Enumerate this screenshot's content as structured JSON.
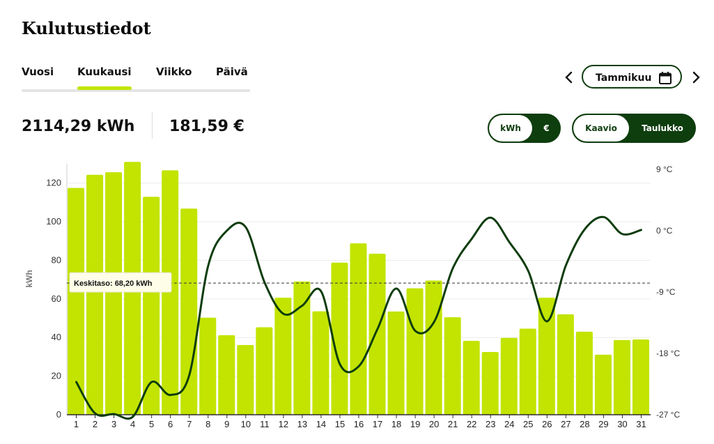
{
  "page": {
    "title": "Kulutustiedot"
  },
  "tabs": [
    {
      "label": "Vuosi",
      "active": false
    },
    {
      "label": "Kuukausi",
      "active": true
    },
    {
      "label": "Viikko",
      "active": false
    },
    {
      "label": "Päivä",
      "active": false
    }
  ],
  "month_selector": {
    "label": "Tammikuu",
    "prev_icon": "chevron-left-icon",
    "next_icon": "chevron-right-icon",
    "calendar_icon": "calendar-icon"
  },
  "totals": {
    "energy": "2114,29 kWh",
    "cost": "181,59 €"
  },
  "unit_toggle": {
    "options": [
      "kWh",
      "€"
    ],
    "selected": "kWh"
  },
  "view_toggle": {
    "options": [
      "Kaavio",
      "Taulukko"
    ],
    "selected": "Kaavio"
  },
  "colors": {
    "bar": "#c2e400",
    "line": "#0e3d0e",
    "accent_dark": "#0e3d0e"
  },
  "chart_data": {
    "type": "bar",
    "ylabel": "kWh",
    "ylim": [
      0,
      130
    ],
    "y_ticks": [
      0,
      20,
      40,
      60,
      80,
      100,
      120
    ],
    "y2_ticks": [
      "-27 °C",
      "-18 °C",
      "-9 °C",
      "0 °C",
      "9 °C"
    ],
    "y2_values": [
      -27,
      -18,
      -9,
      0,
      9
    ],
    "y2lim": [
      -27,
      9.8
    ],
    "categories": [
      "1",
      "2",
      "3",
      "4",
      "5",
      "6",
      "7",
      "8",
      "9",
      "10",
      "11",
      "12",
      "13",
      "14",
      "15",
      "16",
      "17",
      "18",
      "19",
      "20",
      "21",
      "22",
      "23",
      "24",
      "25",
      "26",
      "27",
      "28",
      "29",
      "30",
      "31"
    ],
    "series": [
      {
        "values": [
          117.5,
          124.3,
          125.6,
          131.0,
          112.9,
          126.6,
          106.8,
          50.3,
          41.2,
          36.1,
          45.3,
          60.6,
          69.0,
          53.6,
          78.8,
          88.8,
          83.4,
          53.5,
          65.5,
          69.5,
          50.5,
          38.3,
          32.5,
          39.8,
          44.6,
          60.6,
          52.0,
          43.0,
          31.1,
          38.7,
          39.0
        ]
      },
      {
        "axis": "right",
        "values": [
          -22.2,
          -26.8,
          -26.9,
          -27.3,
          -22.2,
          -24.1,
          -21.2,
          -5.2,
          0.0,
          0.5,
          -7.6,
          -12.2,
          -11.0,
          -8.9,
          -19.6,
          -19.9,
          -14.4,
          -8.5,
          -14.7,
          -13.4,
          -5.5,
          -1.2,
          1.9,
          -1.7,
          -5.9,
          -13.3,
          -5.1,
          0.2,
          2.0,
          -0.5,
          0.1
        ]
      }
    ],
    "average_line": {
      "value": 68.2,
      "label": "Keskitaso: 68,20 kWh"
    },
    "grid": true
  }
}
